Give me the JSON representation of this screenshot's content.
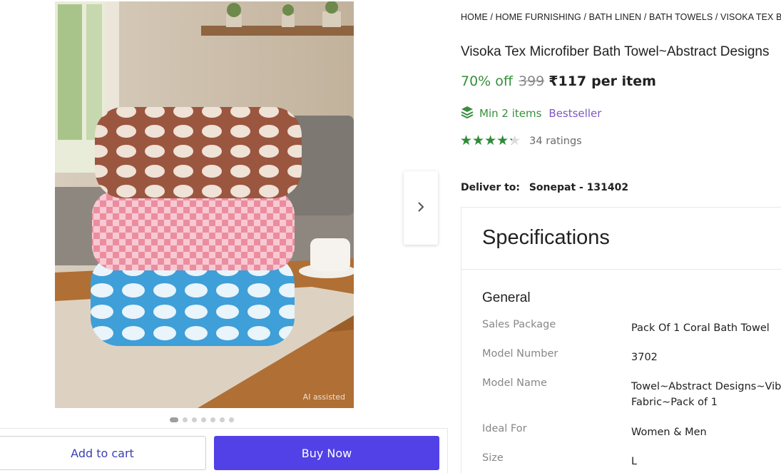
{
  "gallery": {
    "ai_badge": "AI assisted",
    "dots_total": 7,
    "active_dot": 0
  },
  "actions": {
    "add_to_cart": "Add to cart",
    "buy_now": "Buy Now"
  },
  "breadcrumb": "HOME / HOME FURNISHING / BATH LINEN / BATH TOWELS / VISOKA TEX BATH T",
  "product": {
    "title": "Visoka Tex Microfiber Bath Towel~Abstract Designs",
    "discount": "70% off",
    "mrp": "399",
    "price": "₹117",
    "per_item": "per item",
    "min_items": "Min 2 items",
    "badge": "Bestseller",
    "rating_value": 4.3,
    "stars": "★★★★★",
    "ratings_count": "34 ratings"
  },
  "delivery": {
    "label": "Deliver to:",
    "location": "Sonepat - 131402"
  },
  "specs": {
    "heading": "Specifications",
    "group": "General",
    "rows": [
      {
        "key": "Sales Package",
        "value": "Pack Of 1 Coral Bath Towel"
      },
      {
        "key": "Model Number",
        "value": "3702"
      },
      {
        "key": "Model Name",
        "value": "Towel~Abstract Designs~Vibr",
        "value2": "Fabric~Pack of 1"
      },
      {
        "key": "Ideal For",
        "value": "Women & Men"
      },
      {
        "key": "Size",
        "value": "L"
      }
    ]
  },
  "colors": {
    "discount_green": "#388e3c",
    "rating_green": "#2e8b3a",
    "bestseller_purple": "#7e57c2",
    "buy_button": "#5141e6",
    "cart_text": "#3b3fb5"
  },
  "icons": {
    "next": "chevron-right-icon",
    "min_items": "layers-icon",
    "star": "star-icon"
  }
}
